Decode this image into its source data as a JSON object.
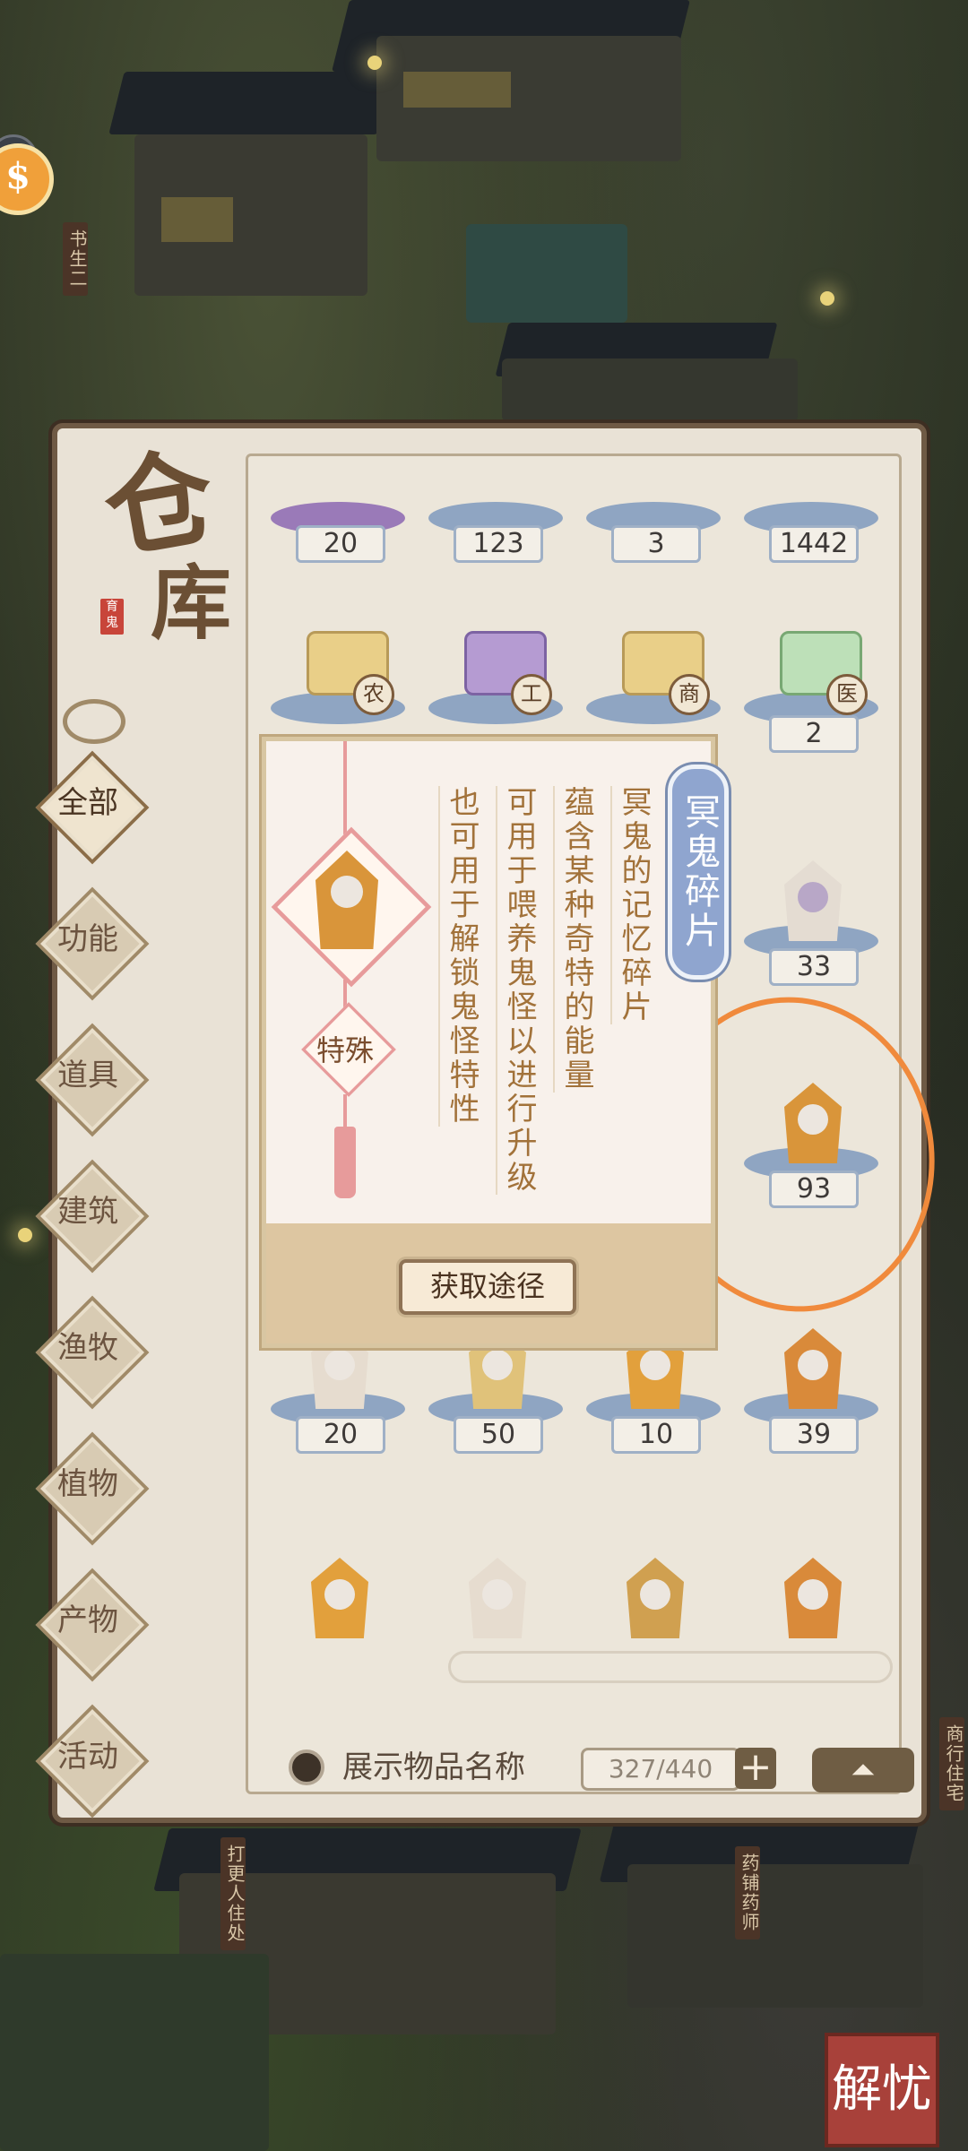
{
  "panel": {
    "title_line1": "仓",
    "title_line2": "库",
    "seal_text": "育鬼",
    "categories": [
      "全部",
      "功能",
      "道具",
      "建筑",
      "渔牧",
      "植物",
      "产物",
      "活动"
    ],
    "active_category": "全部"
  },
  "grid": {
    "row1_counts": [
      "20",
      "123",
      "3",
      "1442"
    ],
    "row2_tags": [
      "农",
      "工",
      "商",
      "医"
    ],
    "row2_count_last": "2",
    "row3_count_last": "33",
    "row4_count_last": "93",
    "row5_counts": [
      "20",
      "50",
      "10",
      "39"
    ]
  },
  "tooltip": {
    "name": "冥鬼碎片",
    "type": "特殊",
    "desc_lines": [
      "冥鬼的记忆碎片",
      "蕴含某种奇特的能量",
      "可用于喂养鬼怪以进行升级",
      "也可用于解锁鬼怪特性"
    ],
    "button": "获取途径"
  },
  "bottom_bar": {
    "show_names_label": "展示物品名称",
    "capacity": "327/440",
    "plus": "+",
    "up": "⏶"
  },
  "map_signs": {
    "sign1": "书生二",
    "sign2": "打更人住处",
    "sign3": "药铺药师",
    "sign4": "商行住宅",
    "corner_button": "解忧"
  }
}
